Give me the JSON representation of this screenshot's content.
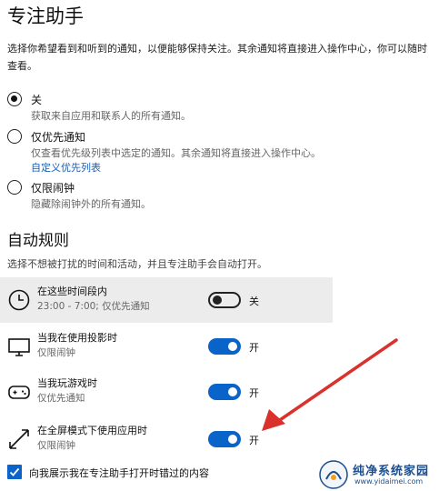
{
  "page": {
    "title": "专注助手",
    "description": "选择你希望看到和听到的通知，以便能够保持关注。其余通知将直接进入操作中心，你可以随时查看。"
  },
  "modes": [
    {
      "label": "关",
      "description": "获取来自应用和联系人的所有通知。",
      "selected": true
    },
    {
      "label": "仅优先通知",
      "description": "仅查看优先级列表中选定的通知。其余通知将直接进入操作中心。",
      "link": "自定义优先列表",
      "selected": false
    },
    {
      "label": "仅限闹钟",
      "description": "隐藏除闹钟外的所有通知。",
      "selected": false
    }
  ],
  "auto_rules": {
    "title": "自动规则",
    "description": "选择不想被打扰的时间和活动，并且专注助手会自动打开。",
    "items": [
      {
        "title": "在这些时间段内",
        "subtitle": "23:00 - 7:00; 仅优先通知",
        "state": "关",
        "on": false,
        "icon": "clock-icon"
      },
      {
        "title": "当我在使用投影时",
        "subtitle": "仅限闹钟",
        "state": "开",
        "on": true,
        "icon": "monitor-icon"
      },
      {
        "title": "当我玩游戏时",
        "subtitle": "仅优先通知",
        "state": "开",
        "on": true,
        "icon": "gamepad-icon"
      },
      {
        "title": "在全屏模式下使用应用时",
        "subtitle": "仅限闹钟",
        "state": "开",
        "on": true,
        "icon": "fullscreen-arrows-icon"
      }
    ]
  },
  "summary_checkbox": {
    "label": "向我展示我在专注助手打开时错过的内容",
    "checked": true
  },
  "watermark": {
    "text": "纯净系统家园",
    "url": "www.yidaimei.com"
  },
  "colors": {
    "accent": "#0a63c9",
    "arrow": "#d9312b",
    "highlight": "#ececec"
  }
}
